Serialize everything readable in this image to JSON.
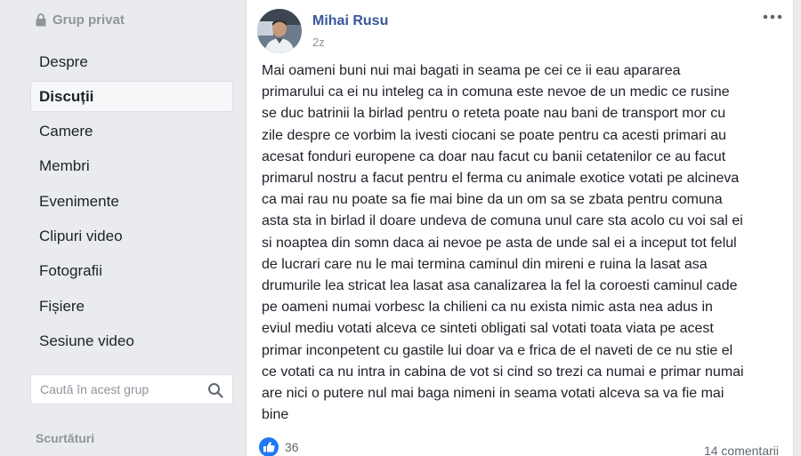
{
  "sidebar": {
    "group_type": "Grup privat",
    "lock_icon": "lock-icon",
    "nav_items": [
      {
        "label": "Despre"
      },
      {
        "label": "Discuții",
        "active": true
      },
      {
        "label": "Camere"
      },
      {
        "label": "Membri"
      },
      {
        "label": "Evenimente"
      },
      {
        "label": "Clipuri video"
      },
      {
        "label": "Fotografii"
      },
      {
        "label": "Fișiere"
      },
      {
        "label": "Sesiune video"
      }
    ],
    "search": {
      "placeholder": "Caută în acest grup",
      "value": "",
      "icon": "search-icon"
    },
    "shortcuts_title": "Scurtături"
  },
  "post": {
    "author": "Mihai Rusu",
    "timestamp": "2z",
    "text": "Mai oameni buni nui mai bagati in seama pe cei ce ii eau apararea\nprimarului ca ei nu inteleg ca in comuna este nevoe de un medic ce rusine\nse duc batrinii la birlad pentru o reteta poate nau bani de transport mor cu\nzile despre ce vorbim la ivesti ciocani se poate pentru ca acesti primari au\nacesat fonduri europene ca doar nau facut cu banii cetatenilor ce au facut\nprimarul nostru a facut pentru el ferma cu animale exotice votati pe alcineva\nca mai rau nu poate sa fie mai bine da un om sa se zbata pentru comuna\nasta sta in birlad il doare undeva de comuna unul care sta acolo cu voi sal ei\nsi noaptea din somn daca ai nevoe pe asta de unde sal ei a inceput tot felul\nde lucrari care nu le mai termina caminul din mireni e ruina la lasat asa\ndrumurile lea stricat lea lasat asa canalizarea la fel la coroesti caminul cade\npe oameni numai vorbesc la chilieni ca nu exista nimic asta nea adus in\neviul mediu votati alceva ce sinteti obligati sal votati toata viata pe acest\nprimar inconpetent cu gastile lui doar va e frica de el naveti de ce nu stie el\nce votati ca nu intra in cabina de vot si cind so trezi ca numai e primar numai\nare nici o putere nul mai baga nimeni in seama votati alceva sa va fie mai\nbine",
    "reactions_count": "36",
    "comments_count": "14 comentarii",
    "like_color": "#2078f4",
    "link_color": "#365899"
  }
}
